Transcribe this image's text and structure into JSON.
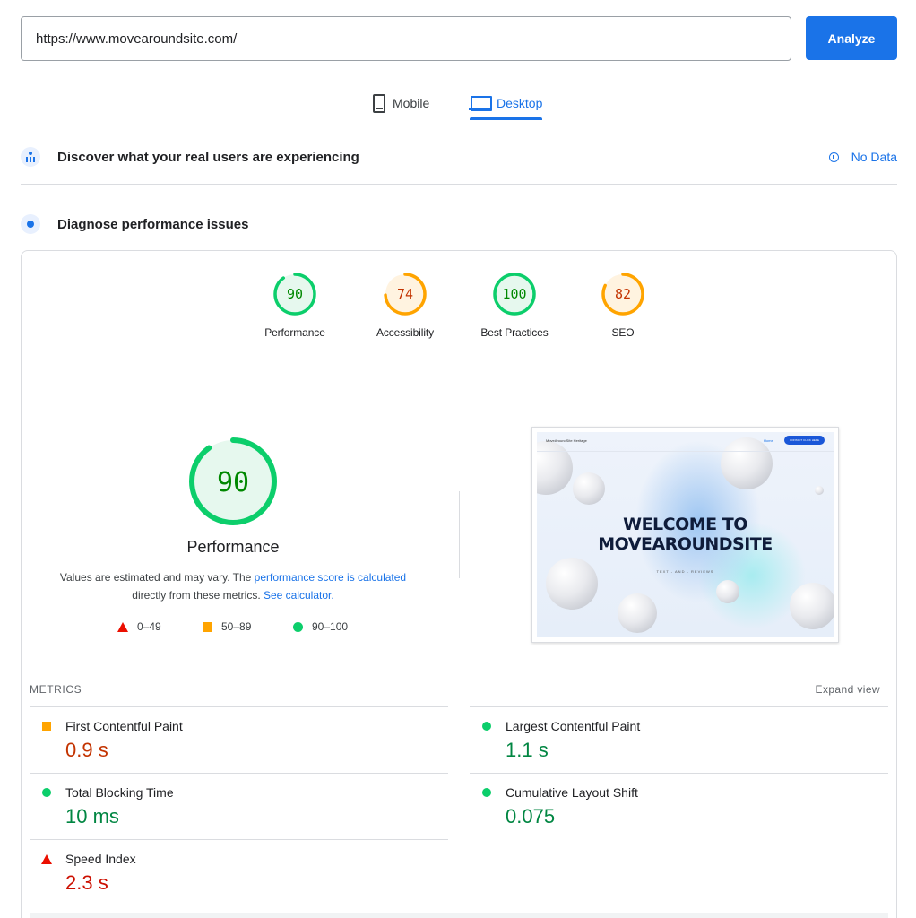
{
  "search": {
    "url_value": "https://www.movearoundsite.com/",
    "analyze_label": "Analyze"
  },
  "tabs": [
    {
      "label": "Mobile",
      "icon": "phone-icon",
      "active": false
    },
    {
      "label": "Desktop",
      "icon": "laptop-icon",
      "active": true
    }
  ],
  "real_users": {
    "title": "Discover what your real users are experiencing",
    "status": "No Data"
  },
  "diagnose": {
    "title": "Diagnose performance issues"
  },
  "scores": [
    {
      "label": "Performance",
      "value": "90",
      "color": "#0cce6b"
    },
    {
      "label": "Accessibility",
      "value": "74",
      "color": "#ffa400"
    },
    {
      "label": "Best Practices",
      "value": "100",
      "color": "#0cce6b"
    },
    {
      "label": "SEO",
      "value": "82",
      "color": "#ffa400"
    }
  ],
  "performance": {
    "score": "90",
    "title": "Performance",
    "desc_text1": "Values are estimated and may vary. The ",
    "desc_link1": "performance score is calculated",
    "desc_text2": "directly from these metrics. ",
    "desc_link2": "See calculator."
  },
  "legend": [
    {
      "shape": "triangle",
      "range": "0–49",
      "color": "#eb0f00"
    },
    {
      "shape": "square",
      "range": "50–89",
      "color": "#ffa400"
    },
    {
      "shape": "circle",
      "range": "90–100",
      "color": "#0cce6b"
    }
  ],
  "screenshot": {
    "heading_line1": "WELCOME TO",
    "heading_line2": "MOVEAROUNDSITE",
    "subtitle": "TEXT - AND - REVIEWS",
    "nav_home": "Home",
    "nav_cta": "CONTACT CLICK HERE",
    "logo": "MoveAroundSite Heritage"
  },
  "metrics": {
    "heading": "METRICS",
    "expand_label": "Expand view",
    "items": [
      {
        "name": "First Contentful Paint",
        "value": "0.9 s",
        "rating": "average"
      },
      {
        "name": "Largest Contentful Paint",
        "value": "1.1 s",
        "rating": "pass"
      },
      {
        "name": "Total Blocking Time",
        "value": "10 ms",
        "rating": "pass"
      },
      {
        "name": "Cumulative Layout Shift",
        "value": "0.075",
        "rating": "pass"
      },
      {
        "name": "Speed Index",
        "value": "2.3 s",
        "rating": "fail"
      }
    ]
  }
}
